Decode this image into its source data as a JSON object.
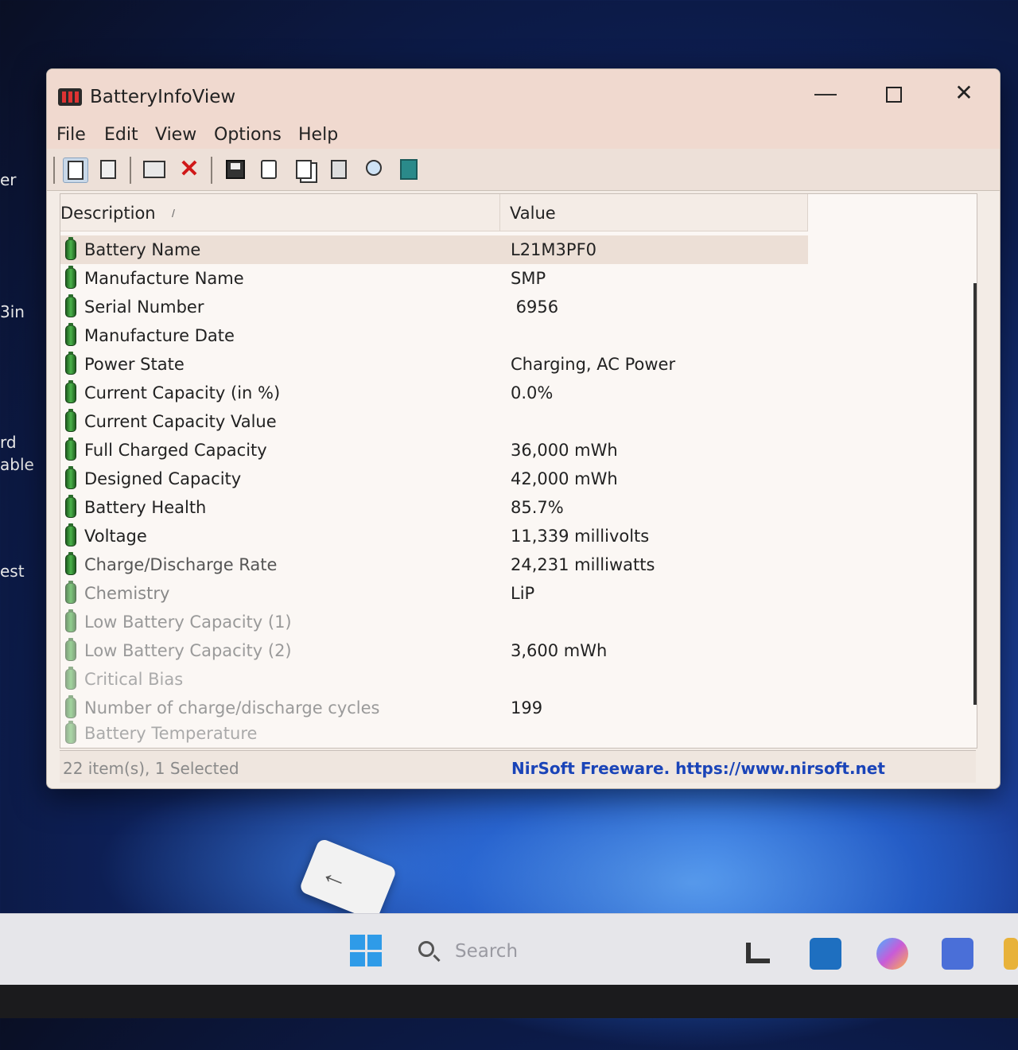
{
  "desktop": {
    "labels": [
      "er",
      "3in",
      "rd",
      "able",
      "est"
    ]
  },
  "window": {
    "title": "BatteryInfoView",
    "minimize_glyph": "—",
    "close_glyph": "✕"
  },
  "menu": {
    "items": [
      "File",
      "Edit",
      "View",
      "Options",
      "Help"
    ]
  },
  "toolbar": {
    "icons": [
      "properties-icon",
      "clipboard-icon",
      "html-report-icon",
      "delete-icon",
      "save-icon",
      "refresh-icon",
      "copy-icon",
      "options-icon",
      "find-icon",
      "exit-icon"
    ]
  },
  "list": {
    "columns": {
      "description": "Description",
      "value": "Value"
    },
    "sort_indicator": "/",
    "rows": [
      {
        "desc": "Battery Name",
        "val": "L21M3PF0"
      },
      {
        "desc": "Manufacture Name",
        "val": "SMP"
      },
      {
        "desc": "Serial Number",
        "val": " 6956"
      },
      {
        "desc": "Manufacture Date",
        "val": ""
      },
      {
        "desc": "Power State",
        "val": "Charging, AC Power"
      },
      {
        "desc": "Current Capacity (in %)",
        "val": "0.0%"
      },
      {
        "desc": "Current Capacity Value",
        "val": ""
      },
      {
        "desc": "Full Charged Capacity",
        "val": "36,000 mWh"
      },
      {
        "desc": "Designed Capacity",
        "val": "42,000 mWh"
      },
      {
        "desc": "Battery Health",
        "val": "85.7%"
      },
      {
        "desc": "Voltage",
        "val": "11,339 millivolts"
      },
      {
        "desc": "Charge/Discharge Rate",
        "val": "24,231 milliwatts"
      },
      {
        "desc": "Chemistry",
        "val": "LiP"
      },
      {
        "desc": "Low Battery Capacity (1)",
        "val": ""
      },
      {
        "desc": "Low Battery Capacity (2)",
        "val": "3,600 mWh"
      },
      {
        "desc": "Critical Bias",
        "val": ""
      },
      {
        "desc": "Number of charge/discharge cycles",
        "val": "199"
      },
      {
        "desc": "Battery Temperature",
        "val": ""
      }
    ]
  },
  "status": {
    "left": "22 item(s), 1 Selected",
    "right": "NirSoft Freeware. https://www.nirsoft.net"
  },
  "taskbar": {
    "search_placeholder": "Search",
    "cursor_glyph": "←"
  },
  "colors": {
    "accent_link": "#1a44b8",
    "battery_green": "#4bb34b",
    "titlebar": "#f0d9cf"
  }
}
